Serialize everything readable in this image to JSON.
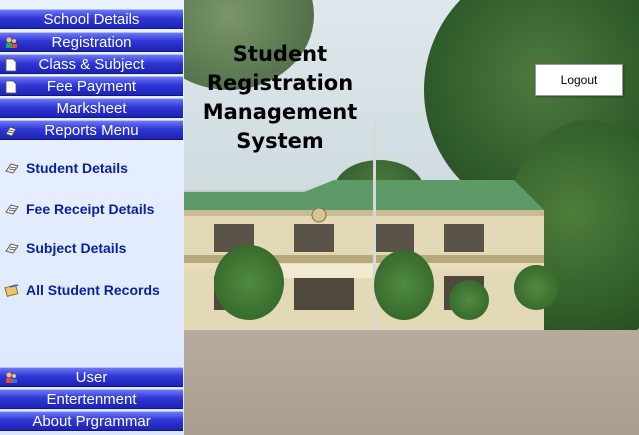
{
  "app": {
    "title": "Student\nRegistration\nManagement\nSystem",
    "logout_label": "Logout"
  },
  "sidebar": {
    "top_menu": [
      {
        "label": "School Details",
        "icon": "none"
      },
      {
        "label": "Registration",
        "icon": "users-icon"
      },
      {
        "label": "Class & Subject",
        "icon": "document-icon"
      },
      {
        "label": "Fee Payment",
        "icon": "document-icon"
      },
      {
        "label": "Marksheet",
        "icon": "none"
      },
      {
        "label": "Reports Menu",
        "icon": "report-icon"
      }
    ],
    "reports_items": [
      {
        "label": "Student Details",
        "icon": "report-icon"
      },
      {
        "label": "Fee Receipt Details",
        "icon": "report-icon"
      },
      {
        "label": "Subject Details",
        "icon": "report-icon"
      },
      {
        "label": "All Student Records",
        "icon": "records-icon"
      }
    ],
    "bottom_menu": [
      {
        "label": "User",
        "icon": "users-icon"
      },
      {
        "label": "Entertenment",
        "icon": "none"
      },
      {
        "label": "About Prgrammar",
        "icon": "none"
      }
    ]
  },
  "colors": {
    "menu_button": "#2f37d6",
    "sub_item_text": "#0b1f9e",
    "sidebar_bg": "#e2ecff"
  }
}
